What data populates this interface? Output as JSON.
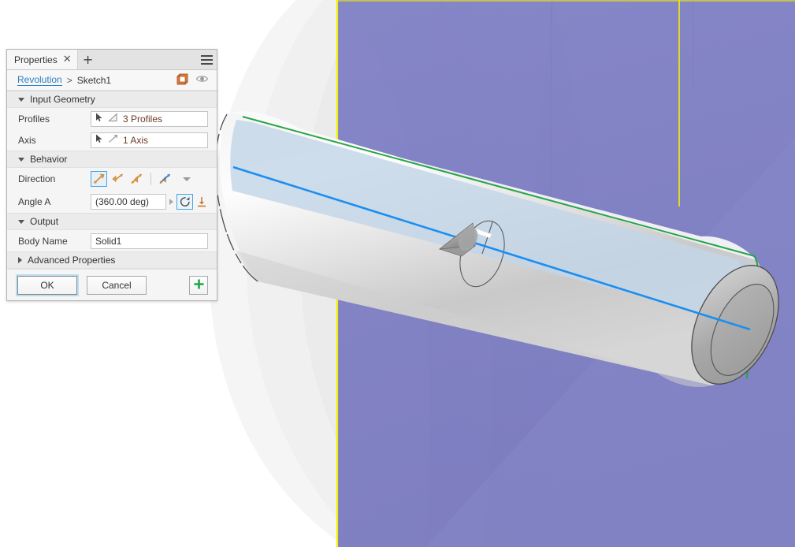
{
  "panel": {
    "tabs": [
      {
        "label": "Properties",
        "close_icon": "close-icon"
      }
    ],
    "add_tab_label": "+",
    "menu_icon": "hamburger-menu-icon",
    "breadcrumb": {
      "parent": "Revolution",
      "separator": ">",
      "current": "Sketch1",
      "cube_icon": "orange-cube-icon",
      "eye_icon": "visibility-eye-icon"
    },
    "sections": [
      {
        "title": "Input Geometry",
        "expanded": true,
        "rows": [
          {
            "label": "Profiles",
            "value": "3 Profiles",
            "select_icon": "cursor-arrow-icon",
            "type_icon": "profile-face-icon"
          },
          {
            "label": "Axis",
            "value": "1 Axis",
            "select_icon": "cursor-arrow-icon",
            "type_icon": "axis-line-icon"
          }
        ]
      },
      {
        "title": "Behavior",
        "expanded": true
      },
      {
        "title": "Output",
        "expanded": true,
        "rows": [
          {
            "label": "Body Name",
            "value": "Solid1"
          }
        ]
      },
      {
        "title": "Advanced Properties",
        "expanded": false
      }
    ],
    "direction": {
      "label": "Direction",
      "options": [
        {
          "name": "direction-one-side",
          "selected": true
        },
        {
          "name": "direction-symmetric",
          "selected": false
        },
        {
          "name": "direction-two-sides",
          "selected": false
        },
        {
          "name": "direction-asymmetric",
          "selected": false
        }
      ],
      "dropdown_icon": "chevron-down-icon"
    },
    "angle": {
      "label": "Angle A",
      "value": "(360.00 deg)",
      "stepper_icon": "expand-arrow-icon",
      "revolve_full_icon": "full-revolution-icon",
      "revolve_full_selected": true,
      "flip_icon": "flip-direction-icon"
    },
    "footer": {
      "ok_label": "OK",
      "cancel_label": "Cancel",
      "add_icon": "green-plus-icon"
    }
  },
  "viewport": {
    "colors": {
      "background": "#ffffff",
      "plane_purple": "#7b7cc0",
      "plane_border_yellow": "#f5f000",
      "axis_blue": "#1c8ef0",
      "edge_green": "#27a545",
      "profile_fill": "#c3d6e8",
      "body_light": "#ededed",
      "body_grey": "#b9b9b9",
      "endcap_grey": "#a9a9a9",
      "outline_dark": "#4c4c4c"
    },
    "elements": [
      {
        "name": "revolved-cylinder-body"
      },
      {
        "name": "sketch-profile-highlight"
      },
      {
        "name": "revolution-axis-line"
      },
      {
        "name": "construction-plane-purple"
      },
      {
        "name": "plane-boundary-yellow"
      },
      {
        "name": "direction-arrow-manipulator"
      },
      {
        "name": "angle-rotation-handle"
      },
      {
        "name": "ghost-preview-body"
      }
    ]
  }
}
